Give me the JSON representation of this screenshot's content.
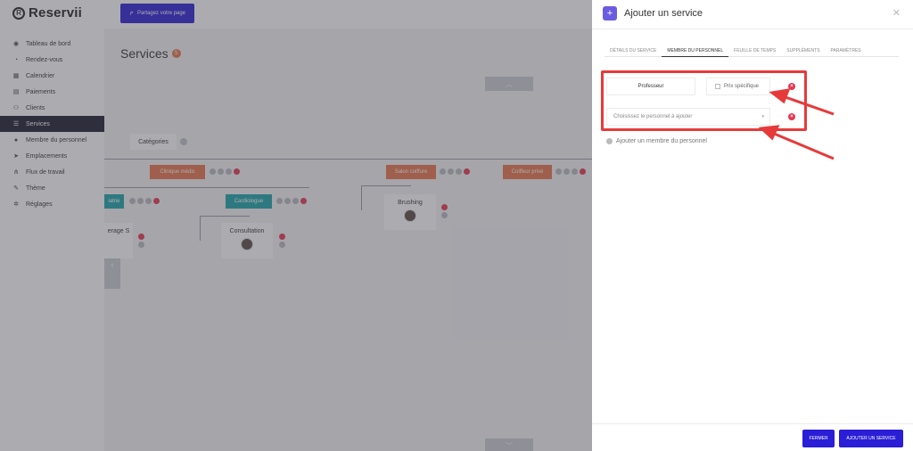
{
  "app": {
    "logo_text": "Reservii",
    "share_button": "Partagez votre page"
  },
  "sidebar": {
    "items": [
      {
        "label": "Tableau de bord",
        "icon": "dashboard-icon"
      },
      {
        "label": "Rendez-vous",
        "icon": "clock-icon"
      },
      {
        "label": "Calendrier",
        "icon": "calendar-icon"
      },
      {
        "label": "Paiements",
        "icon": "payment-icon"
      },
      {
        "label": "Clients",
        "icon": "users-icon"
      },
      {
        "label": "Services",
        "icon": "services-icon",
        "active": true
      },
      {
        "label": "Membre du personnel",
        "icon": "user-icon"
      },
      {
        "label": "Emplacements",
        "icon": "location-icon"
      },
      {
        "label": "Flux de travail",
        "icon": "workflow-icon"
      },
      {
        "label": "Thème",
        "icon": "brush-icon"
      },
      {
        "label": "Réglages",
        "icon": "gear-icon"
      }
    ]
  },
  "main": {
    "title": "Services",
    "count": "5",
    "tree": {
      "root": "Catégories",
      "cat1": "Clinique médic",
      "cat2": "Salon coiffure",
      "cat3": "Coiffeur privé",
      "sub1": "iatrie",
      "sub2": "Cardiologue",
      "leaf1": "erage S",
      "leaf2": "Consultation",
      "leaf3": "Brushing"
    }
  },
  "modal": {
    "title": "Ajouter un service",
    "tabs": [
      {
        "label": "DÉTAILS DU SERVICE",
        "active": false
      },
      {
        "label": "MEMBRE DU PERSONNEL",
        "active": true
      },
      {
        "label": "FEUILLE DE TEMPS",
        "active": false
      },
      {
        "label": "SUPPLÉMENTS",
        "active": false
      },
      {
        "label": "PARAMÈTRES",
        "active": false
      }
    ],
    "staff_member": "Professeur",
    "specific_price_label": "Prix spécifique",
    "select_placeholder": "Choisissez le personnel à ajouter",
    "add_staff_label": "Ajouter un membre du personnel",
    "close_button": "FERMER",
    "submit_button": "AJOUTER UN SERVICE"
  },
  "colors": {
    "accent": "#2a1ed6",
    "highlight": "#e63a3a",
    "danger": "#e8344e",
    "category": "#e8734a",
    "subcategory": "#1aa3a8"
  }
}
